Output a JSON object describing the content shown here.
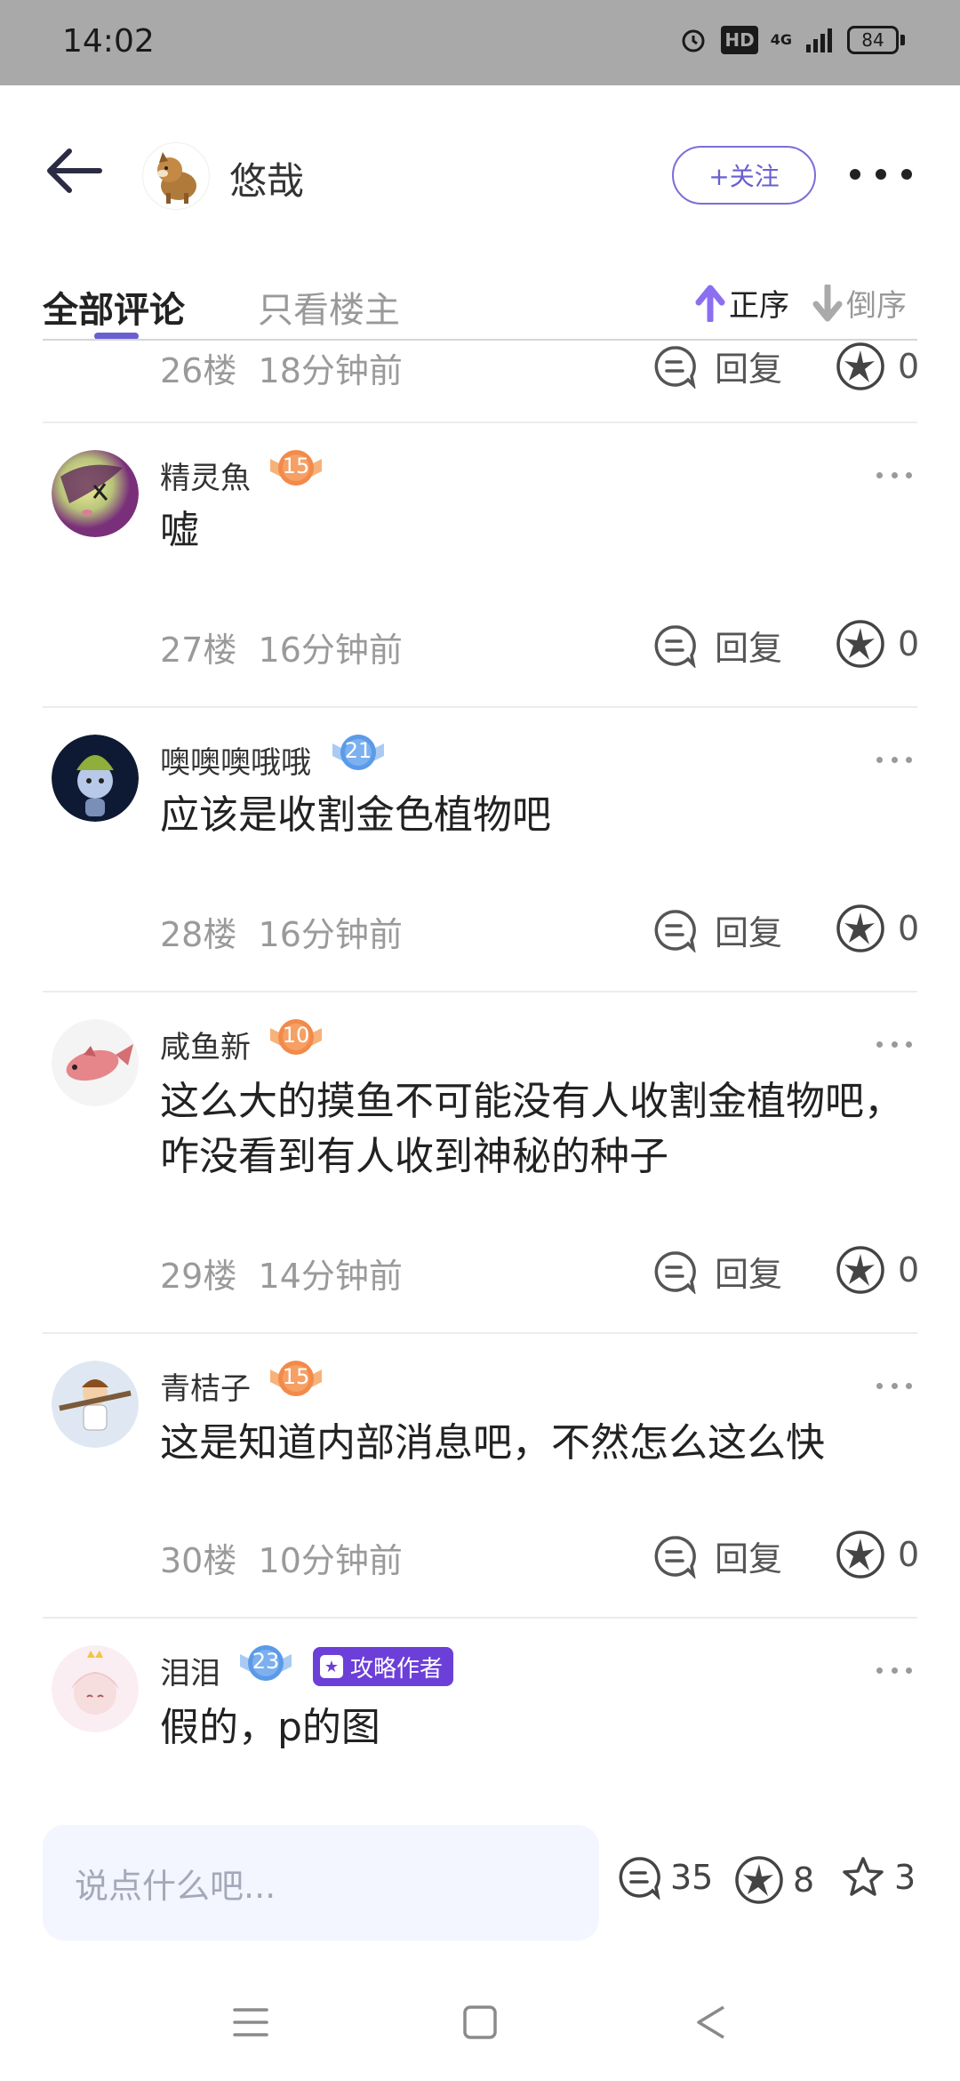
{
  "status_bar": {
    "time": "14:02",
    "hd": "HD",
    "network": "4G",
    "battery": "84"
  },
  "header": {
    "username": "悠哉",
    "follow_label": "+关注"
  },
  "tabs": {
    "all_comments": "全部评论",
    "owner_only": "只看楼主",
    "sort_asc": "正序",
    "sort_desc": "倒序",
    "accent_color": "#6a5fd0"
  },
  "partial_comment": {
    "floor": "26楼",
    "time": "18分钟前",
    "reply_label": "回复",
    "likes": "0"
  },
  "comments": [
    {
      "name": "精灵魚",
      "level": "15",
      "level_color": "#f28a4a",
      "text": "嘘",
      "floor": "27楼",
      "time": "16分钟前",
      "reply_label": "回复",
      "likes": "0"
    },
    {
      "name": "噢噢噢哦哦",
      "level": "21",
      "level_color": "#5b9ae8",
      "text": "应该是收割金色植物吧",
      "floor": "28楼",
      "time": "16分钟前",
      "reply_label": "回复",
      "likes": "0"
    },
    {
      "name": "咸鱼新",
      "level": "10",
      "level_color": "#f28a4a",
      "text": "这么大的摸鱼不可能没有人收割金植物吧，咋没看到有人收到神秘的种子",
      "floor": "29楼",
      "time": "14分钟前",
      "reply_label": "回复",
      "likes": "0"
    },
    {
      "name": "青桔子",
      "level": "15",
      "level_color": "#f28a4a",
      "text": "这是知道内部消息吧，不然怎么这么快",
      "floor": "30楼",
      "time": "10分钟前",
      "reply_label": "回复",
      "likes": "0"
    },
    {
      "name": "泪泪",
      "level": "23",
      "level_color": "#5b9ae8",
      "tag": "攻略作者",
      "text": "假的，p的图"
    }
  ],
  "bottom_bar": {
    "input_placeholder": "说点什么吧...",
    "comment_count": "35",
    "like_count": "8",
    "star_count": "3"
  }
}
